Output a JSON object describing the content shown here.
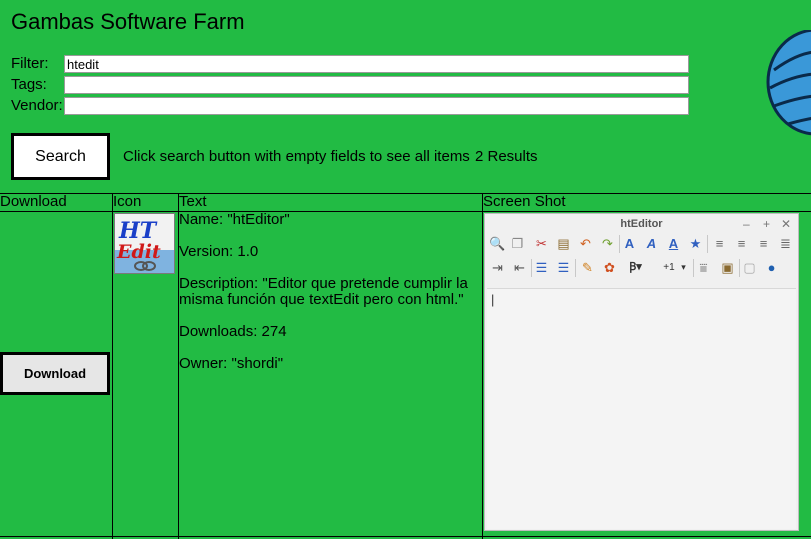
{
  "app": {
    "title": "Gambas Software Farm"
  },
  "form": {
    "filter_label": "Filter:",
    "filter_value": "htedit",
    "tags_label": "Tags:",
    "tags_value": "",
    "vendor_label": "Vendor:",
    "vendor_value": ""
  },
  "search": {
    "button_label": "Search",
    "hint": "Click search button with empty fields to see all items",
    "results": "2 Results"
  },
  "table": {
    "headers": [
      "Download",
      "Icon",
      "Text",
      "Screen Shot"
    ],
    "rows": [
      {
        "download_label": "Download",
        "icon": "htedit-app-icon",
        "icon_text": "HT Edit",
        "name_line": "Name: \"htEditor\"",
        "version_line": "Version: 1.0",
        "description_line": "Description: \"Editor que pretende cumplir la misma función que textEdit pero con html.\"",
        "downloads_line": "Downloads: 274",
        "owner_line": "Owner: \"shordi\"",
        "screenshot": {
          "window_title": "htEditor",
          "window_controls": [
            "–",
            "+",
            "✕"
          ],
          "caret": "|",
          "toolbar_row1": [
            "search-icon",
            "copy-icon",
            "cut-icon",
            "paste-icon",
            "undo-icon",
            "redo-icon",
            "font-a-icon",
            "italic-a-icon",
            "underline-a-icon",
            "star-icon",
            "align-left-icon",
            "align-center-icon",
            "align-right-icon",
            "justify-icon"
          ],
          "toolbar_row2": [
            "indent-in-icon",
            "indent-out-icon",
            "list-bullets-icon",
            "list-numbered-icon",
            "color-icon",
            "paint-icon",
            "font-size-icon",
            "+1",
            "rule-icon",
            "image-icon",
            "doc-icon",
            "globe-icon"
          ]
        }
      }
    ]
  },
  "colors": {
    "page_bg": "#22bb44",
    "logo_blue": "#3a98d8"
  }
}
